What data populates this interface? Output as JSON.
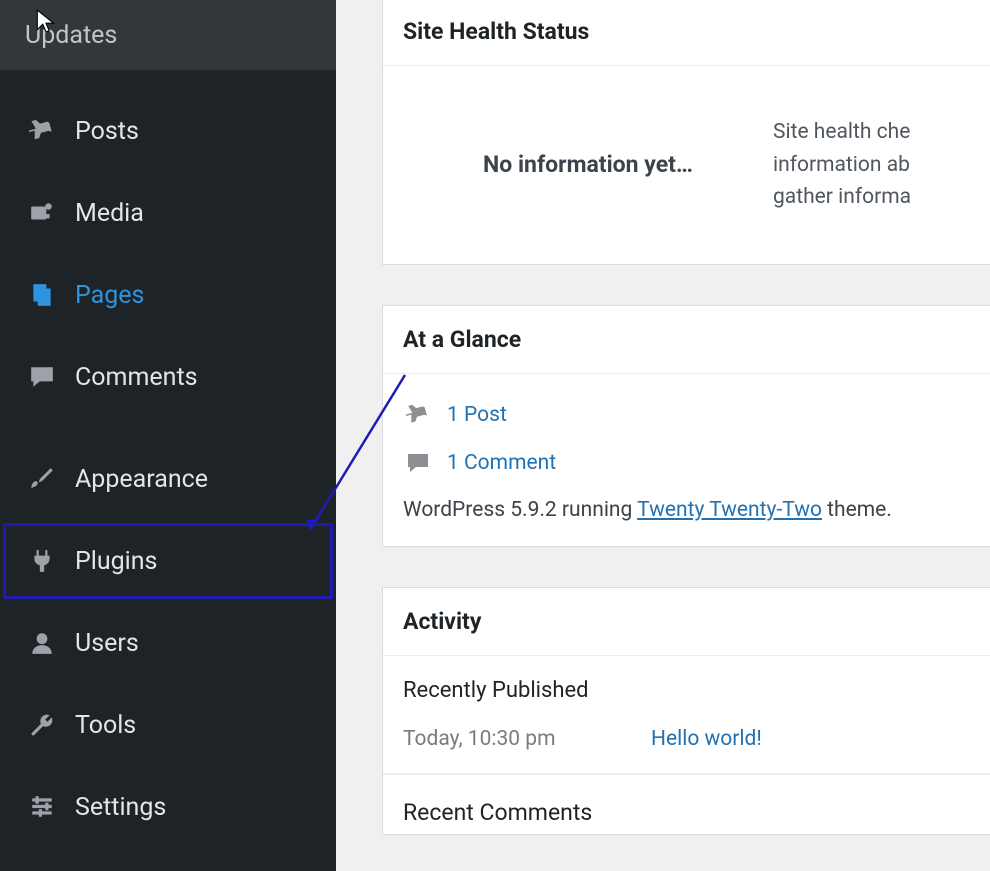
{
  "sidebar": {
    "top": "Updates",
    "items": [
      {
        "label": "Posts",
        "icon": "pin-icon"
      },
      {
        "label": "Media",
        "icon": "media-icon"
      },
      {
        "label": "Pages",
        "icon": "pages-icon",
        "active": true
      },
      {
        "label": "Comments",
        "icon": "comment-icon"
      },
      {
        "label": "Appearance",
        "icon": "brush-icon"
      },
      {
        "label": "Plugins",
        "icon": "plug-icon",
        "highlighted": true
      },
      {
        "label": "Users",
        "icon": "user-icon"
      },
      {
        "label": "Tools",
        "icon": "wrench-icon"
      },
      {
        "label": "Settings",
        "icon": "sliders-icon"
      }
    ]
  },
  "health": {
    "title": "Site Health Status",
    "no_info": "No information yet…",
    "desc_line1": "Site health che",
    "desc_line2": "information ab",
    "desc_line3": "gather informa"
  },
  "glance": {
    "title": "At a Glance",
    "post_link": "1 Post",
    "comment_link": "1 Comment",
    "version_prefix": "WordPress 5.9.2 running ",
    "theme_link": "Twenty Twenty-Two",
    "version_suffix": " theme."
  },
  "activity": {
    "title": "Activity",
    "recent_published": "Recently Published",
    "item_time": "Today, 10:30 pm",
    "item_title": "Hello world!",
    "recent_comments": "Recent Comments"
  }
}
